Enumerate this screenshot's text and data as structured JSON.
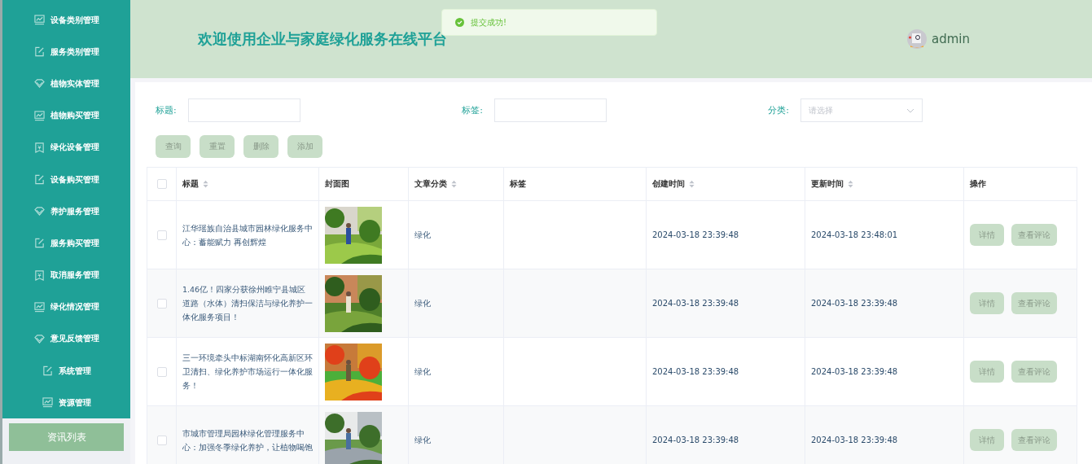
{
  "sidebar": {
    "menu": [
      {
        "label": "设备类别管理"
      },
      {
        "label": "服务类别管理"
      },
      {
        "label": "植物实体管理"
      },
      {
        "label": "植物购买管理"
      },
      {
        "label": "绿化设备管理"
      },
      {
        "label": "设备购买管理"
      },
      {
        "label": "养护服务管理"
      },
      {
        "label": "服务购买管理"
      },
      {
        "label": "取消服务管理"
      },
      {
        "label": "绿化情况管理"
      },
      {
        "label": "意见反馈管理"
      },
      {
        "label": "系统管理"
      },
      {
        "label": "资源管理"
      }
    ],
    "submenu": [
      {
        "label": "资讯列表",
        "selected": true
      }
    ]
  },
  "header": {
    "title": "欢迎使用企业与家庭绿化服务在线平台",
    "user": "admin"
  },
  "toast": {
    "message": "提交成功!"
  },
  "filters": [
    {
      "kind": "text",
      "label": "标题:"
    },
    {
      "kind": "text",
      "label": "标签:"
    },
    {
      "kind": "select",
      "label": "分类:",
      "placeholder": "请选择"
    }
  ],
  "actions": [
    "查询",
    "重置",
    "删除",
    "添加"
  ],
  "table": {
    "select_all_checked": false,
    "columns": [
      {
        "label": "标题",
        "sortable": true
      },
      {
        "label": "封面图",
        "sortable": false
      },
      {
        "label": "文章分类",
        "sortable": true
      },
      {
        "label": "标签",
        "sortable": false
      },
      {
        "label": "创建时间",
        "sortable": true
      },
      {
        "label": "更新时间",
        "sortable": true
      },
      {
        "label": "操作",
        "sortable": false
      }
    ],
    "rows": [
      {
        "checked": false,
        "title": "江华瑶族自治县城市园林绿化服务中心：蓄能赋力 再创辉煌",
        "cover": {
          "kind": "picture"
        },
        "category": "绿化",
        "created": "2024-03-18 23:39:48",
        "updated": "2024-03-18 23:48:01",
        "buttons": [
          "详情",
          "查看评论"
        ]
      },
      {
        "checked": false,
        "title": "1.46亿！四家分获徐州睢宁县城区道路（水体）清扫保洁与绿化养护一体化服务项目！",
        "cover": {
          "kind": "picture"
        },
        "category": "绿化",
        "created": "2024-03-18 23:39:48",
        "updated": "2024-03-18 23:39:48",
        "buttons": [
          "详情",
          "查看评论"
        ]
      },
      {
        "checked": false,
        "title": "三一环境牵头中标湖南怀化高新区环卫清扫、绿化养护市场运行一体化服务！",
        "cover": {
          "kind": "picture"
        },
        "category": "绿化",
        "created": "2024-03-18 23:39:48",
        "updated": "2024-03-18 23:39:48",
        "buttons": [
          "详情",
          "查看评论"
        ]
      },
      {
        "checked": false,
        "title": "市城市管理局园林绿化管理服务中心：加强冬季绿化养护，让植物喝饱",
        "cover": {
          "kind": "picture"
        },
        "category": "绿化",
        "created": "2024-03-18 23:39:48",
        "updated": "2024-03-18 23:39:48",
        "buttons": [
          "详情",
          "查看评论"
        ]
      }
    ]
  }
}
